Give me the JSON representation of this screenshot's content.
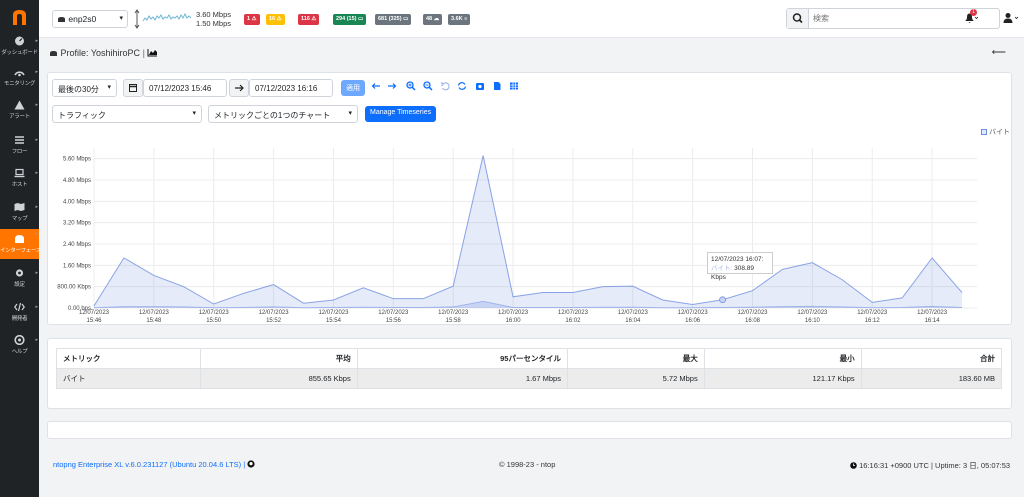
{
  "sidebar": {
    "items": [
      {
        "label": "ダッシュボード",
        "icon": "dashboard-icon"
      },
      {
        "label": "モニタリング",
        "icon": "monitoring-icon"
      },
      {
        "label": "アラート",
        "icon": "alert-icon"
      },
      {
        "label": "フロー",
        "icon": "flows-icon"
      },
      {
        "label": "ホスト",
        "icon": "hosts-icon"
      },
      {
        "label": "マップ",
        "icon": "map-icon"
      },
      {
        "label": "インターフェース",
        "icon": "interface-icon",
        "active": true
      },
      {
        "label": "設定",
        "icon": "settings-icon"
      },
      {
        "label": "開発者",
        "icon": "developer-icon"
      },
      {
        "label": "ヘルプ",
        "icon": "help-icon"
      }
    ]
  },
  "topbar": {
    "interface": "enp2s0",
    "throughput_up": "3.60 Mbps",
    "throughput_down": "1.50 Mbps",
    "badges": [
      {
        "text": "1",
        "color": "#dc3545",
        "icon": "warning-icon"
      },
      {
        "text": "16",
        "color": "#ffc107",
        "icon": "warning-icon"
      },
      {
        "text": "116",
        "color": "#dc3545",
        "icon": "warning-icon"
      },
      {
        "text": "294 (15)",
        "color": "#198754",
        "icon": "laptop-icon"
      },
      {
        "text": "681 (325)",
        "color": "#6c757d",
        "icon": "laptop-icon"
      },
      {
        "text": "48",
        "color": "#6c757d",
        "icon": "cloud-icon"
      },
      {
        "text": "3.6K",
        "color": "#6c757d",
        "icon": "flows-icon"
      }
    ],
    "search_placeholder": "検索",
    "notification_count": "1"
  },
  "page": {
    "title": "Profile: YoshihiroPC",
    "separator": "|"
  },
  "controls": {
    "range": "最後の30分",
    "start": "07/12/2023 15:46",
    "end": "07/12/2023 16:16",
    "apply": "適用",
    "metric": "トラフィック",
    "chart_mode": "メトリックごとの1つのチャート",
    "manage": "Manage Timeseries"
  },
  "chart_data": {
    "type": "area",
    "series": [
      {
        "name": "バイト",
        "color": "#6f8fe0",
        "values": [
          0.08,
          1.88,
          1.22,
          0.8,
          0.15,
          0.55,
          0.88,
          0.18,
          0.3,
          0.76,
          0.35,
          0.35,
          0.82,
          5.72,
          0.42,
          0.58,
          0.58,
          0.8,
          0.82,
          0.3,
          0.13,
          0.31,
          0.65,
          1.45,
          1.7,
          1.06,
          0.21,
          0.38,
          1.88,
          0.58
        ]
      },
      {
        "name": "",
        "color": "#9ab0ea",
        "values": [
          0.01,
          0.05,
          0.05,
          0.04,
          0.01,
          0.02,
          0.04,
          0.01,
          0.02,
          0.03,
          0.02,
          0.02,
          0.04,
          0.25,
          0.02,
          0.02,
          0.02,
          0.03,
          0.03,
          0.01,
          0.01,
          0.02,
          0.03,
          0.05,
          0.06,
          0.04,
          0.01,
          0.02,
          0.06,
          0.02
        ]
      }
    ],
    "ylabel": "",
    "ylim": [
      0,
      6
    ],
    "ytick_labels": [
      "0.00 bps",
      "800.00 Kbps",
      "1.60 Mbps",
      "2.40 Mbps",
      "3.20 Mbps",
      "4.00 Mbps",
      "4.80 Mbps",
      "5.60 Mbps"
    ],
    "ytick_values": [
      0,
      0.8,
      1.6,
      2.4,
      3.2,
      4.0,
      4.8,
      5.6
    ],
    "xtick_labels": [
      [
        "12/07/2023",
        "15:46"
      ],
      [
        "12/07/2023",
        "15:48"
      ],
      [
        "12/07/2023",
        "15:50"
      ],
      [
        "12/07/2023",
        "15:52"
      ],
      [
        "12/07/2023",
        "15:54"
      ],
      [
        "12/07/2023",
        "15:56"
      ],
      [
        "12/07/2023",
        "15:58"
      ],
      [
        "12/07/2023",
        "16:00"
      ],
      [
        "12/07/2023",
        "16:02"
      ],
      [
        "12/07/2023",
        "16:04"
      ],
      [
        "12/07/2023",
        "16:06"
      ],
      [
        "12/07/2023",
        "16:08"
      ],
      [
        "12/07/2023",
        "16:10"
      ],
      [
        "12/07/2023",
        "16:12"
      ],
      [
        "12/07/2023",
        "16:14"
      ]
    ],
    "xlim": [
      "07/12/2023 15:46",
      "07/12/2023 16:15"
    ],
    "x_start": "15:46",
    "x_step": "1 min",
    "legend": "top-right",
    "grid": true
  },
  "tooltip": {
    "time": "12/07/2023 16:07:",
    "series": "バイト:",
    "value": "308.89 Kbps",
    "highlight_index": 21
  },
  "stats": {
    "headers": [
      "メトリック",
      "平均",
      "95パーセンタイル",
      "最大",
      "最小",
      "合計"
    ],
    "rows": [
      [
        "バイト",
        "855.65 Kbps",
        "1.67 Mbps",
        "5.72 Mbps",
        "121.17 Kbps",
        "183.60 MB"
      ]
    ]
  },
  "footer": {
    "version": "ntopng Enterprise XL v.6.0.231127 (Ubuntu 20.04.6 LTS) |",
    "copyright": "© 1998-23 - ntop",
    "uptime": "16:16:31 +0900 UTC | Uptime: 3 日, 05:07:53"
  }
}
